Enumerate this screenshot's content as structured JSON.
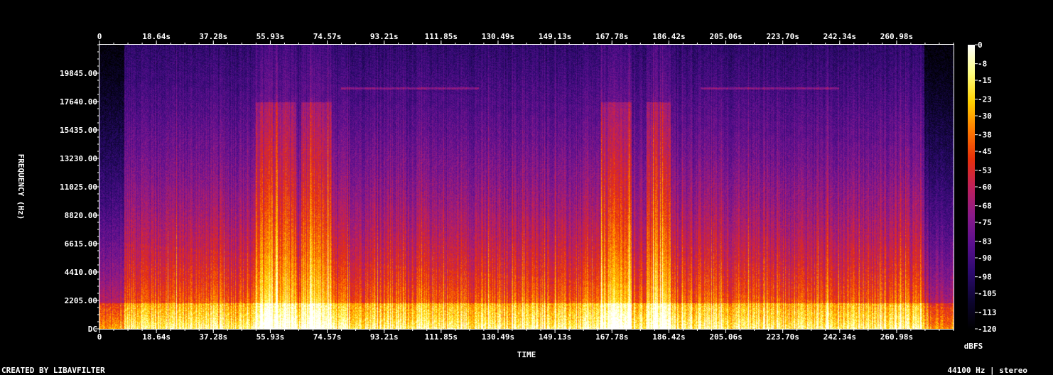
{
  "chart_data": {
    "type": "heatmap",
    "title": "",
    "xlabel": "TIME",
    "ylabel": "FREQUENCY (Hz)",
    "colorbar_label": "dBFS",
    "x_ticks": [
      "0",
      "18.64s",
      "37.28s",
      "55.93s",
      "74.57s",
      "93.21s",
      "111.85s",
      "130.49s",
      "149.13s",
      "167.78s",
      "186.42s",
      "205.06s",
      "223.70s",
      "242.34s",
      "260.98s"
    ],
    "x_tick_values": [
      0,
      18.64,
      37.28,
      55.93,
      74.57,
      93.21,
      111.85,
      130.49,
      149.13,
      167.78,
      186.42,
      205.06,
      223.7,
      242.34,
      260.98
    ],
    "xlim": [
      0,
      279.6
    ],
    "y_ticks": [
      "DC",
      "2205.00",
      "4410.00",
      "6615.00",
      "8820.00",
      "11025.00",
      "13230.00",
      "15435.00",
      "17640.00",
      "19845.00"
    ],
    "y_tick_values": [
      0,
      2205,
      4410,
      6615,
      8820,
      11025,
      13230,
      15435,
      17640,
      19845
    ],
    "ylim": [
      0,
      22050
    ],
    "colorbar_ticks": [
      "0",
      "-8",
      "-15",
      "-23",
      "-30",
      "-38",
      "-45",
      "-53",
      "-60",
      "-68",
      "-75",
      "-83",
      "-90",
      "-98",
      "-105",
      "-113",
      "-120"
    ],
    "colorbar_values": [
      0,
      -8,
      -15,
      -23,
      -30,
      -38,
      -45,
      -53,
      -60,
      -68,
      -75,
      -83,
      -90,
      -98,
      -105,
      -113,
      -120
    ],
    "color_range_dbfs": [
      -120,
      0
    ],
    "colormap": [
      "#000000",
      "#0d0530",
      "#2c0a6e",
      "#5a0f8e",
      "#8a1a8a",
      "#c0205a",
      "#e8300a",
      "#ff7a00",
      "#ffd000",
      "#ffff80",
      "#ffffff"
    ],
    "bright_sections_s": [
      [
        51,
        64
      ],
      [
        66,
        76
      ],
      [
        164,
        174
      ],
      [
        179,
        187
      ]
    ],
    "quiet_sections_s": [
      [
        0,
        8
      ],
      [
        270,
        279.6
      ]
    ],
    "tonal_line_hz": 18700,
    "tonal_line_sections_s": [
      [
        79,
        124
      ],
      [
        197,
        242
      ]
    ]
  },
  "footer": {
    "credit": "CREATED BY LIBAVFILTER",
    "format": "44100 Hz | stereo"
  }
}
